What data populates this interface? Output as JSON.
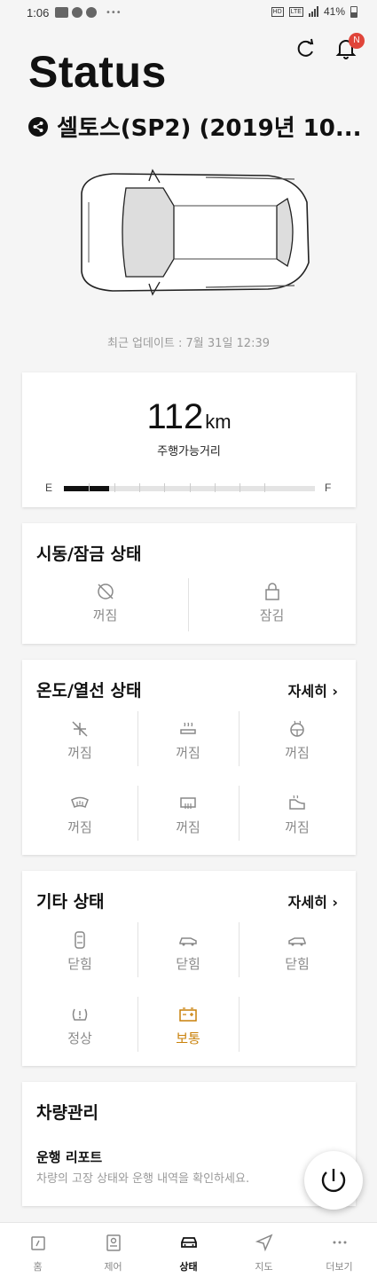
{
  "statusbar": {
    "time": "1:06",
    "battery": "41%"
  },
  "header": {
    "title": "Status",
    "notification_badge": "N",
    "car_name": "셀토스(SP2) (2019년 10..."
  },
  "last_update": "최근 업데이트 : 7월 31일 12:39",
  "range": {
    "value": "112",
    "unit": "km",
    "label": "주행가능거리",
    "empty_label": "E",
    "full_label": "F",
    "fuel_level": 0.18
  },
  "ignition_lock": {
    "title": "시동/잠금 상태",
    "items": [
      {
        "icon": "ignition-off-icon",
        "label": "꺼짐"
      },
      {
        "icon": "lock-icon",
        "label": "잠김"
      }
    ]
  },
  "climate": {
    "title": "온도/열선 상태",
    "more": "자세히",
    "items": [
      {
        "icon": "air-conditioner-off-icon",
        "label": "꺼짐"
      },
      {
        "icon": "seat-heater-icon",
        "label": "꺼짐"
      },
      {
        "icon": "steering-wheel-heater-icon",
        "label": "꺼짐"
      },
      {
        "icon": "front-defroster-icon",
        "label": "꺼짐"
      },
      {
        "icon": "rear-defroster-icon",
        "label": "꺼짐"
      },
      {
        "icon": "mirror-heater-icon",
        "label": "꺼짐"
      }
    ]
  },
  "misc": {
    "title": "기타 상태",
    "more": "자세히",
    "items": [
      {
        "icon": "door-icon",
        "label": "닫힘",
        "warn": false
      },
      {
        "icon": "trunk-icon",
        "label": "닫힘",
        "warn": false
      },
      {
        "icon": "hood-icon",
        "label": "닫힘",
        "warn": false
      },
      {
        "icon": "tire-pressure-icon",
        "label": "정상",
        "warn": false
      },
      {
        "icon": "battery-icon",
        "label": "보통",
        "warn": true
      }
    ],
    "warn_color": "#c9810a"
  },
  "vehicle_care": {
    "title": "차량관리",
    "report_title": "운행 리포트",
    "report_desc": "차량의 고장 상태와 운행 내역을 확인하세요."
  },
  "nav": {
    "items": [
      {
        "icon": "home-icon",
        "label": "홈"
      },
      {
        "icon": "control-icon",
        "label": "제어"
      },
      {
        "icon": "car-status-icon",
        "label": "상태"
      },
      {
        "icon": "map-icon",
        "label": "지도"
      },
      {
        "icon": "more-icon",
        "label": "더보기"
      }
    ],
    "active": "상태"
  }
}
